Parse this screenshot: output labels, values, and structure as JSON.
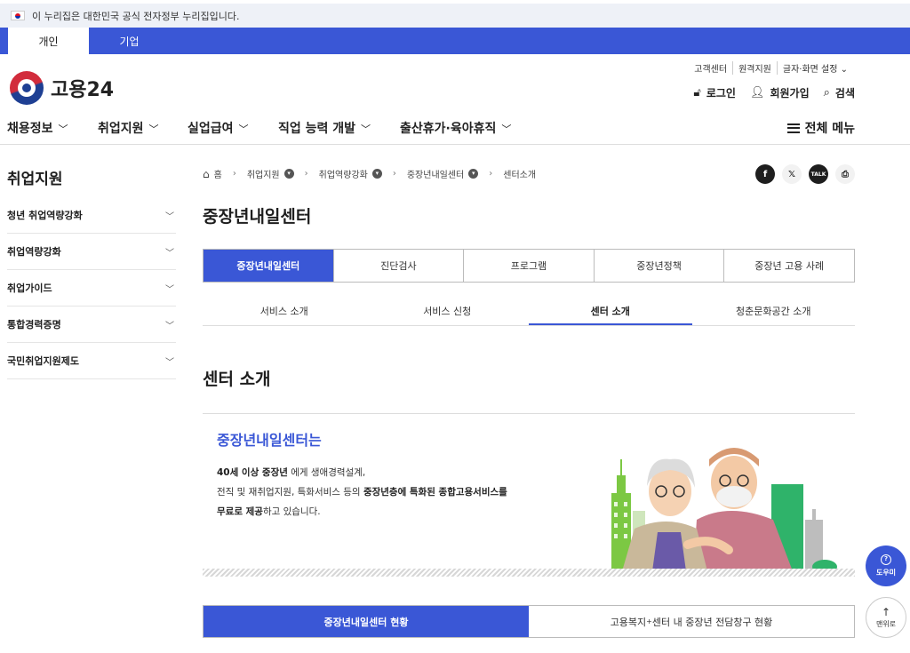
{
  "gov_banner": {
    "text": "이 누리집은 대한민국 공식 전자정부 누리집입니다."
  },
  "audience_tabs": [
    "개인",
    "기업"
  ],
  "logo": {
    "text": "고용24"
  },
  "util_links": [
    "고객센터",
    "원격지원",
    "글자·화면 설정 ⌄"
  ],
  "user_links": {
    "login": "로그인",
    "signup": "회원가입",
    "search": "검색"
  },
  "gnb": {
    "items": [
      "채용정보",
      "취업지원",
      "실업급여",
      "직업 능력 개발",
      "출산휴가·육아휴직"
    ],
    "all_menu": "전체 메뉴"
  },
  "sidebar": {
    "title": "취업지원",
    "items": [
      "청년 취업역량강화",
      "취업역량강화",
      "취업가이드",
      "통합경력증명",
      "국민취업지원제도"
    ]
  },
  "breadcrumb": [
    "홈",
    "취업지원",
    "취업역량강화",
    "중장년내일센터",
    "센터소개"
  ],
  "share": {
    "facebook": "f",
    "x": "𝕏",
    "talk": "TALK",
    "print": "⎙"
  },
  "page_title": "중장년내일센터",
  "tabs": [
    "중장년내일센터",
    "진단검사",
    "프로그램",
    "중장년정책",
    "중장년 고용 사례"
  ],
  "sub_tabs": [
    "서비스 소개",
    "서비스 신청",
    "센터 소개",
    "청춘문화공간 소개"
  ],
  "section_title": "센터 소개",
  "intro": {
    "heading": "중장년내일센터는",
    "line1_bold": "40세 이상 중장년",
    "line1_rest": " 에게 생애경력설계,",
    "line2_pre": "전직 및 재취업지원, 특화서비스 등의 ",
    "line2_bold": "중장년층에 특화된 종합고용서비스를",
    "line3_bold": "무료로 제공",
    "line3_rest": "하고 있습니다."
  },
  "bottom_tabs": {
    "first": "중장년내일센터 현황",
    "second_pre": "고용복지",
    "second_sup": "+",
    "second_post": "센터 내 중장년 전담창구 현황"
  },
  "floating": {
    "help": "도우미",
    "top": "맨위로"
  },
  "colors": {
    "primary": "#3a57d6",
    "banner_bg": "#eef1f7"
  }
}
